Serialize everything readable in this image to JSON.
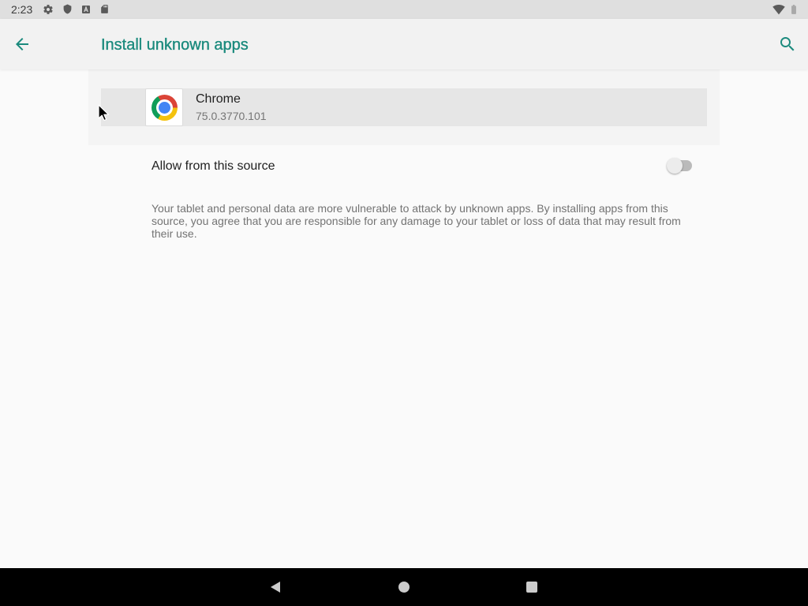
{
  "status_bar": {
    "time": "2:23",
    "left_icons": [
      "gear-icon",
      "shield-icon",
      "text-a-icon",
      "sd-card-icon"
    ],
    "right_icons": [
      "wifi-icon",
      "battery-icon"
    ]
  },
  "app_bar": {
    "back_icon": "arrow-left-icon",
    "title": "Install unknown apps",
    "search_icon": "search-icon"
  },
  "app": {
    "icon": "chrome-icon",
    "name": "Chrome",
    "version": "75.0.3770.101"
  },
  "allow_setting": {
    "label": "Allow from this source",
    "enabled": false
  },
  "warning_text": "Your tablet and personal data are more vulnerable to attack by unknown apps. By installing apps from this source, you agree that you are responsible for any damage to your tablet or loss of data that may result from their use.",
  "nav_bar": {
    "icons": [
      "nav-back-icon",
      "nav-home-icon",
      "nav-recents-icon"
    ]
  },
  "pointer": "mouse-pointer-icon",
  "colors": {
    "accent": "#1b8a7d",
    "status_bar": "#dfdfdf",
    "app_bar": "#f2f2f2",
    "background": "#fafafa",
    "nav_bar": "#000000"
  }
}
